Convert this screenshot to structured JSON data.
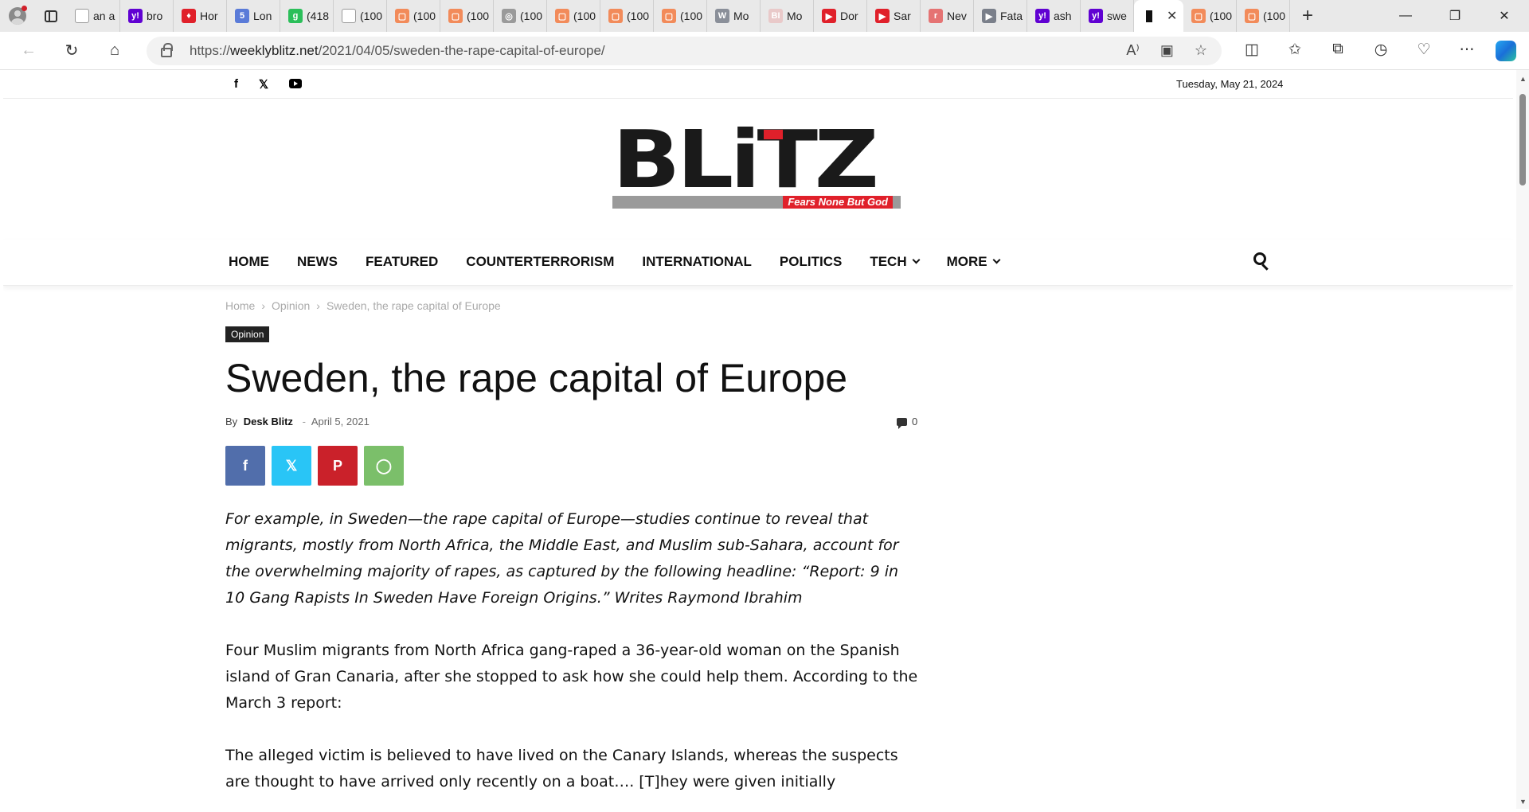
{
  "browser": {
    "tabs": [
      {
        "label": "an a",
        "fav_color": "#ffffff",
        "fav_char": "",
        "fav_icon": "page-icon"
      },
      {
        "label": "bro",
        "fav_color": "#6001d2",
        "fav_char": "y!",
        "fav_icon": "yahoo-icon"
      },
      {
        "label": "Hor",
        "fav_color": "#e0202a",
        "fav_char": "♦",
        "fav_icon": "news-icon"
      },
      {
        "label": "Lon",
        "fav_color": "#5a7bd8",
        "fav_char": "5",
        "fav_icon": "five-icon"
      },
      {
        "label": "(418",
        "fav_color": "#2bbf5a",
        "fav_char": "g",
        "fav_icon": "grammarly-icon"
      },
      {
        "label": "(100",
        "fav_color": "#ffffff",
        "fav_char": "",
        "fav_icon": "page-icon"
      },
      {
        "label": "(100",
        "fav_color": "#f28b5a",
        "fav_char": "▢",
        "fav_icon": "substack-icon"
      },
      {
        "label": "(100",
        "fav_color": "#f28b5a",
        "fav_char": "▢",
        "fav_icon": "substack-icon"
      },
      {
        "label": "(100",
        "fav_color": "#9a9a9a",
        "fav_char": "◎",
        "fav_icon": "globe-icon"
      },
      {
        "label": "(100",
        "fav_color": "#f28b5a",
        "fav_char": "▢",
        "fav_icon": "substack-icon"
      },
      {
        "label": "(100",
        "fav_color": "#f28b5a",
        "fav_char": "▢",
        "fav_icon": "substack-icon"
      },
      {
        "label": "(100",
        "fav_color": "#f28b5a",
        "fav_char": "▢",
        "fav_icon": "substack-icon"
      },
      {
        "label": "Mo",
        "fav_color": "#8a8f99",
        "fav_char": "W",
        "fav_icon": "wordpress-icon"
      },
      {
        "label": "Mo",
        "fav_color": "#e9c9c9",
        "fav_char": "BI",
        "fav_icon": "blitz-icon"
      },
      {
        "label": "Dor",
        "fav_color": "#e0202a",
        "fav_char": "▶",
        "fav_icon": "youtube-icon"
      },
      {
        "label": "Sar",
        "fav_color": "#e0202a",
        "fav_char": "▶",
        "fav_icon": "youtube-icon"
      },
      {
        "label": "Nev",
        "fav_color": "#e57373",
        "fav_char": "r",
        "fav_icon": "r-icon"
      },
      {
        "label": "Fata",
        "fav_color": "#7a7f8a",
        "fav_char": "▶",
        "fav_icon": "tag-icon"
      },
      {
        "label": "ash",
        "fav_color": "#6001d2",
        "fav_char": "y!",
        "fav_icon": "yahoo-icon"
      },
      {
        "label": "swe",
        "fav_color": "#6001d2",
        "fav_char": "y!",
        "fav_icon": "yahoo-icon"
      }
    ],
    "active_tab": {
      "fav_color": "#111111",
      "fav_icon": "blitz-favicon-icon",
      "close": "✕"
    },
    "tabs_after": [
      {
        "label": "(100",
        "fav_color": "#f28b5a",
        "fav_char": "▢",
        "fav_icon": "substack-icon"
      },
      {
        "label": "(100",
        "fav_color": "#f28b5a",
        "fav_char": "▢",
        "fav_icon": "substack-icon"
      }
    ],
    "new_tab": "+",
    "url_prefix": "https://",
    "url_host": "weeklyblitz.net",
    "url_path": "/2021/04/05/sweden-the-rape-capital-of-europe/",
    "window_controls": {
      "minimize": "—",
      "restore": "❐",
      "close": "✕"
    }
  },
  "site": {
    "date": "Tuesday, May 21, 2024",
    "logo_word": "BLiTZ",
    "logo_tagline": "Fears None But God",
    "nav": [
      {
        "label": "HOME",
        "dropdown": false
      },
      {
        "label": "NEWS",
        "dropdown": false
      },
      {
        "label": "FEATURED",
        "dropdown": false
      },
      {
        "label": "COUNTERTERRORISM",
        "dropdown": false
      },
      {
        "label": "INTERNATIONAL",
        "dropdown": false
      },
      {
        "label": "POLITICS",
        "dropdown": false
      },
      {
        "label": "TECH",
        "dropdown": true
      },
      {
        "label": "MORE",
        "dropdown": true
      }
    ]
  },
  "article": {
    "breadcrumb": [
      "Home",
      "Opinion",
      "Sweden, the rape capital of Europe"
    ],
    "breadcrumb_sep": "›",
    "category": "Opinion",
    "title": "Sweden, the rape capital of Europe",
    "by": "By",
    "author": "Desk Blitz",
    "date_sep": "-",
    "date": "April 5, 2021",
    "comment_count": "0",
    "share": {
      "facebook": "f",
      "x": "𝕏",
      "pinterest": "P",
      "whatsapp": "◯"
    },
    "paragraphs": [
      {
        "italic": true,
        "text": "For example, in Sweden—the rape capital of Europe—studies continue to reveal that migrants, mostly from North Africa, the Middle East, and Muslim sub-Sahara, account for the overwhelming majority of rapes, as captured by the following headline: “Report: 9 in 10 Gang Rapists In Sweden Have Foreign Origins.” Writes Raymond Ibrahim"
      },
      {
        "italic": false,
        "text": "Four Muslim migrants from North Africa gang-raped a 36-year-old woman on the Spanish island of Gran Canaria, after she stopped to ask how she could help them.  According to the March 3 report:"
      },
      {
        "italic": false,
        "text": "The alleged victim is believed to have lived on the Canary Islands, whereas the suspects are thought to have arrived only recently on a boat….  [T]hey were given initially"
      }
    ]
  }
}
